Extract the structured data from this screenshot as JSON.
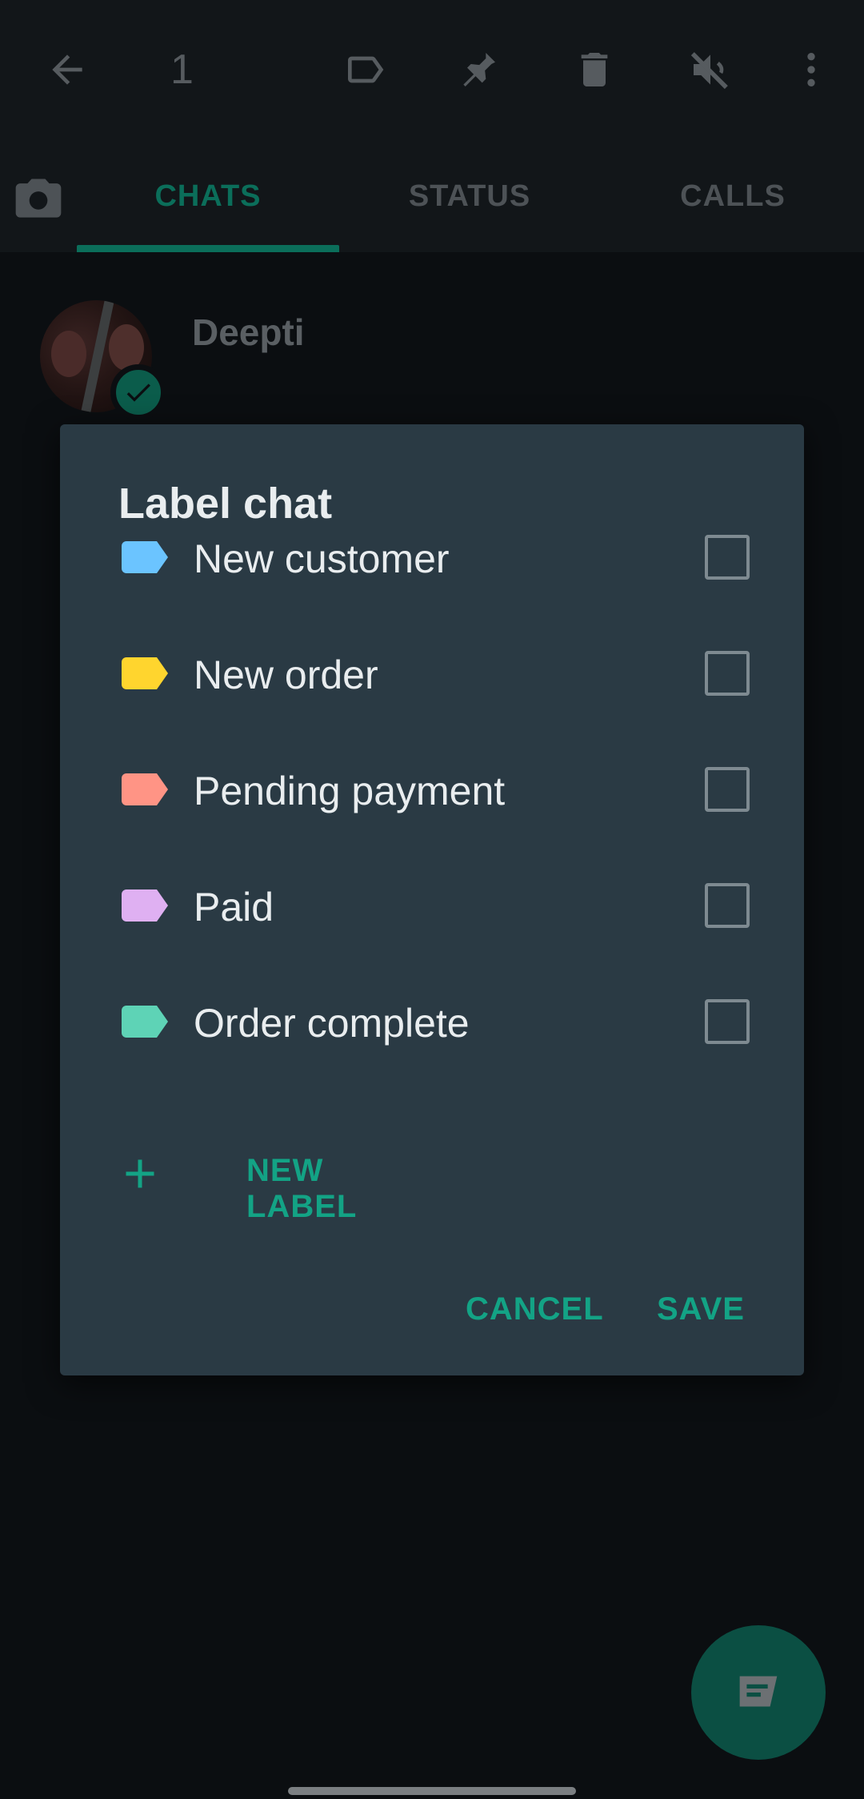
{
  "action_bar": {
    "selected_count": "1",
    "icons": [
      "back-arrow-icon",
      "label-icon",
      "pin-icon",
      "delete-icon",
      "mute-icon",
      "more-vert-icon"
    ],
    "icon_color": "#565b5f"
  },
  "tabs": {
    "items": [
      {
        "label": "CHATS",
        "active": true
      },
      {
        "label": "STATUS",
        "active": false
      },
      {
        "label": "CALLS",
        "active": false
      }
    ],
    "accent_color": "#0b6e5a"
  },
  "chat": {
    "name": "Deepti"
  },
  "dialog": {
    "title": "Label chat",
    "labels": [
      {
        "text": "New customer",
        "color": "#6bc4ff",
        "checked": false
      },
      {
        "text": "New order",
        "color": "#ffd52e",
        "checked": false
      },
      {
        "text": "Pending payment",
        "color": "#ff9485",
        "checked": false
      },
      {
        "text": "Paid",
        "color": "#dfb0f2",
        "checked": false
      },
      {
        "text": "Order complete",
        "color": "#5ed3b6",
        "checked": false
      }
    ],
    "new_label": "NEW LABEL",
    "cancel": "CANCEL",
    "save": "SAVE",
    "accent_color": "#13a385"
  },
  "fab": {
    "icon": "new-chat-icon"
  }
}
